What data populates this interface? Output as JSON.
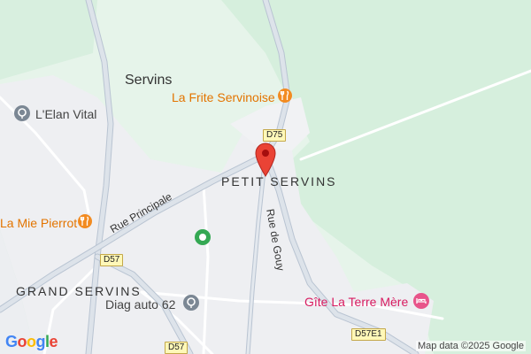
{
  "map": {
    "places": {
      "town": "Servins",
      "hamlet_center": "PETIT SERVINS",
      "hamlet_west": "GRAND SERVINS"
    },
    "pois": [
      {
        "name": "La Frite Servinoise",
        "category": "restaurant",
        "icon": "fork-knife-icon",
        "color": "#e37400"
      },
      {
        "name": "L'Elan Vital",
        "category": "place",
        "icon": "pin-icon",
        "color": "#5f6368"
      },
      {
        "name": "La Mie Pierrot",
        "category": "restaurant",
        "icon": "fork-knife-icon",
        "color": "#e37400"
      },
      {
        "name": "Diag auto 62",
        "category": "place",
        "icon": "pin-icon",
        "color": "#5f6368"
      },
      {
        "name": "Gîte La Terre Mère",
        "category": "lodging",
        "icon": "bed-icon",
        "color": "#d81b60"
      }
    ],
    "roads": {
      "rue_principale": "Rue Principale",
      "rue_de_gouy": "Rue de Gouy"
    },
    "shields": [
      "D75",
      "D57",
      "D57",
      "D57E1"
    ],
    "selected_marker": {
      "icon": "red-pin-icon",
      "color": "#ea4335"
    },
    "attribution": "Map data ©2025 Google",
    "logo": "Google"
  }
}
